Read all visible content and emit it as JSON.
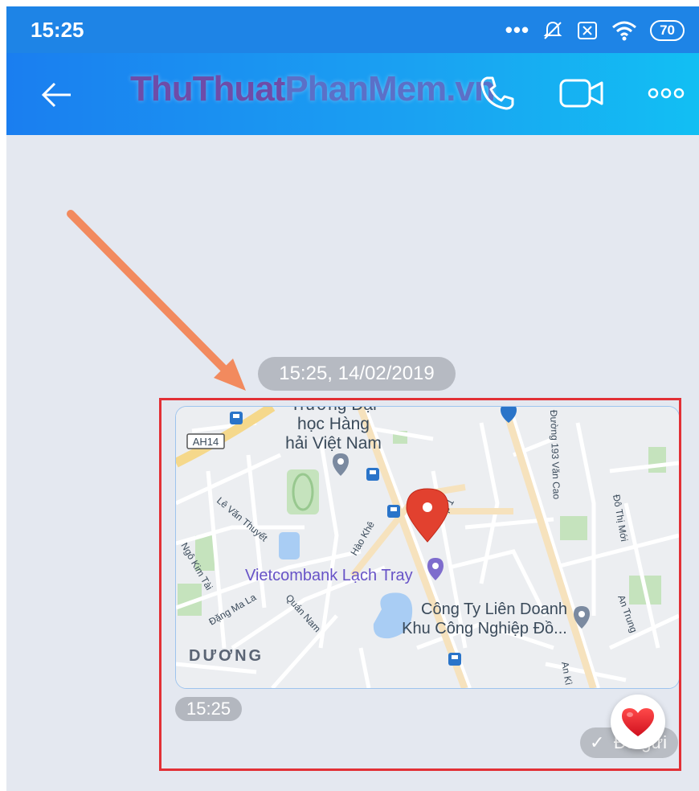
{
  "status_bar": {
    "time": "15:25",
    "battery": "70"
  },
  "header": {
    "title_part1": "ThuThuat",
    "title_part2": "PhanMem.vn"
  },
  "chat": {
    "date_separator": "15:25, 14/02/2019",
    "message_time": "15:25",
    "sent_status": "Đã gửi"
  },
  "map": {
    "labels": {
      "school": "Trường Đại",
      "school2": "học Hàng",
      "school3": "hải Việt Nam",
      "road_ah14": "AH14",
      "le_van_thuyet": "Lê Văn Thuyết",
      "ngo_kim_tai": "Ngô Kim Tài",
      "dang_ma_la": "Đặng Ma La",
      "quan_nam": "Quán Nam",
      "hao_khe": "Hào Khê",
      "vietcombank": "Vietcombank Lạch Tray",
      "company1": "Công Ty Liên Doanh",
      "company2": "Khu Công Nghiệp Đồ...",
      "duong": "DƯƠNG",
      "van_cao": "Đường 193 Văn Cao",
      "do_thi_moi": "Đô Thị Mới",
      "an_trung": "An Trung",
      "an_kim": "An Kì",
      "hip1": "p 1"
    }
  }
}
